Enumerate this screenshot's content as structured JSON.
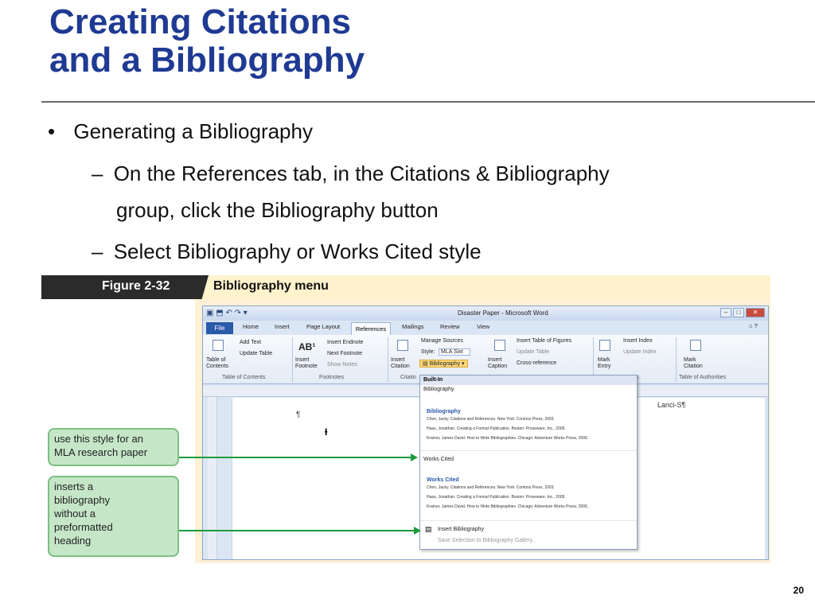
{
  "slide": {
    "title_line1": "Creating Citations",
    "title_line2": "and a Bibliography",
    "bullet": "Generating a Bibliography",
    "sub1_line1": "On the References tab, in the Citations & Bibliography",
    "sub1_line2": "group, click the Bibliography button",
    "sub2": "Select Bibliography or Works Cited style",
    "dash": "–",
    "dot": "•",
    "page_number": "20"
  },
  "figure": {
    "number": "Figure 2-32",
    "caption": "Bibliography menu"
  },
  "word": {
    "window_title": "Disaster Paper - Microsoft Word",
    "tabs": [
      "File",
      "Home",
      "Insert",
      "Page Layout",
      "References",
      "Mailings",
      "Review",
      "View"
    ],
    "ribbon": {
      "toc_label": "Table of Contents",
      "add_text": "Add Text",
      "update_table": "Update Table",
      "group_toc": "Table of Contents",
      "insert_footnote": "Insert Footnote",
      "insert_endnote": "Insert Endnote",
      "next_footnote": "Next Footnote",
      "show_notes": "Show Notes",
      "group_footnotes": "Footnotes",
      "insert_citation": "Insert Citation",
      "manage_sources": "Manage Sources",
      "style_label": "Style:",
      "style_value": "MLA Sixt",
      "bibliography_btn": "Bibliography",
      "group_citations": "Citatio",
      "insert_caption": "Insert Caption",
      "insert_tof": "Insert Table of Figures",
      "update_table2": "Update Table",
      "cross_reference": "Cross-reference",
      "mark_entry": "Mark Entry",
      "insert_index": "Insert Index",
      "update_index": "Update Index",
      "group_index": "x",
      "mark_citation": "Mark Citation",
      "group_toa": "Table of Authorities"
    },
    "doc_header": "Lanci-S¶",
    "pilcrow": "¶"
  },
  "menu": {
    "builtin": "Built-In",
    "bib_label": "Bibliography",
    "bib_heading": "Bibliography",
    "entries": [
      "Chen, Jacky. Citations and References. New York: Contoso Press, 2003.",
      "Haas, Jonathan. Creating a Formal Publication. Boston: Proseware, Inc., 2005.",
      "Kramer, James David. How to Write Bibliographies. Chicago: Adventure Works Press, 2006."
    ],
    "wc_label": "Works Cited",
    "wc_heading": "Works Cited",
    "insert_bib": "Insert Bibliography",
    "save_selection": "Save Selection to Bibliography Gallery..."
  },
  "callouts": {
    "mla": [
      "use this style for an",
      "MLA research paper"
    ],
    "insert": [
      "inserts a",
      "bibliography",
      "without a",
      "preformatted",
      "heading"
    ]
  },
  "colors": {
    "title": "#1f3a93",
    "callout_bg": "#c6e6c8",
    "arrow": "#1d9a3a"
  }
}
